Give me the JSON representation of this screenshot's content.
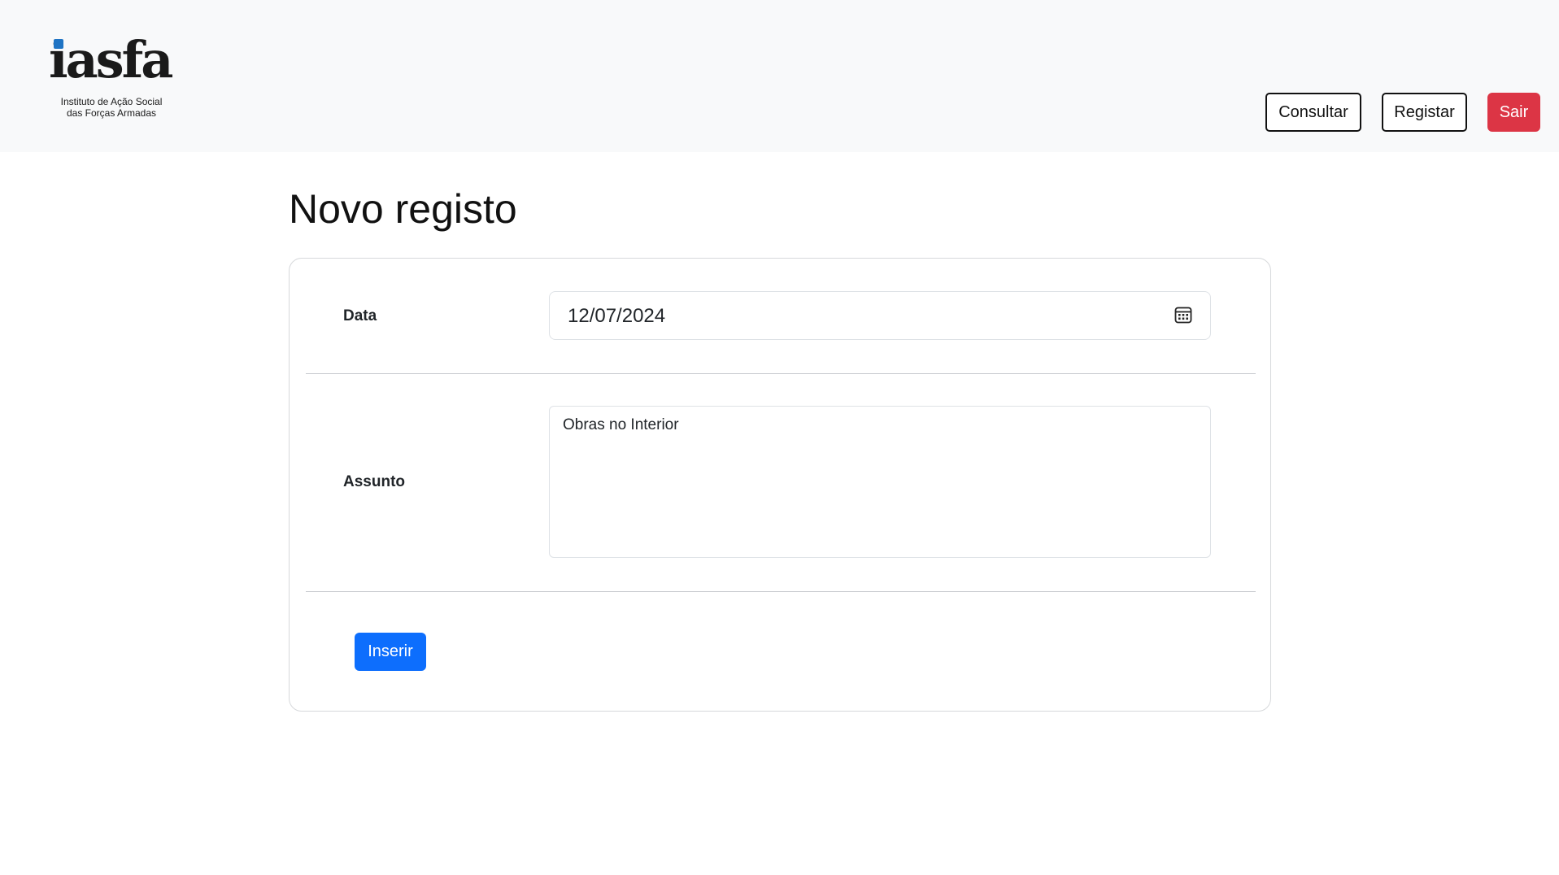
{
  "header": {
    "logo": {
      "wordmark": "iasfa",
      "tagline_line1": "Instituto de Ação Social",
      "tagline_line2": "das Forças Armadas"
    },
    "nav": {
      "consultar_label": "Consultar",
      "registar_label": "Registar",
      "sair_label": "Sair"
    }
  },
  "main": {
    "title": "Novo registo",
    "form": {
      "data_label": "Data",
      "data_value": "12/07/2024",
      "assunto_label": "Assunto",
      "assunto_value": "Obras no Interior",
      "submit_label": "Inserir"
    }
  },
  "colors": {
    "primary": "#0d6efd",
    "danger": "#dc3545",
    "header_bg": "#f8f9fa"
  }
}
